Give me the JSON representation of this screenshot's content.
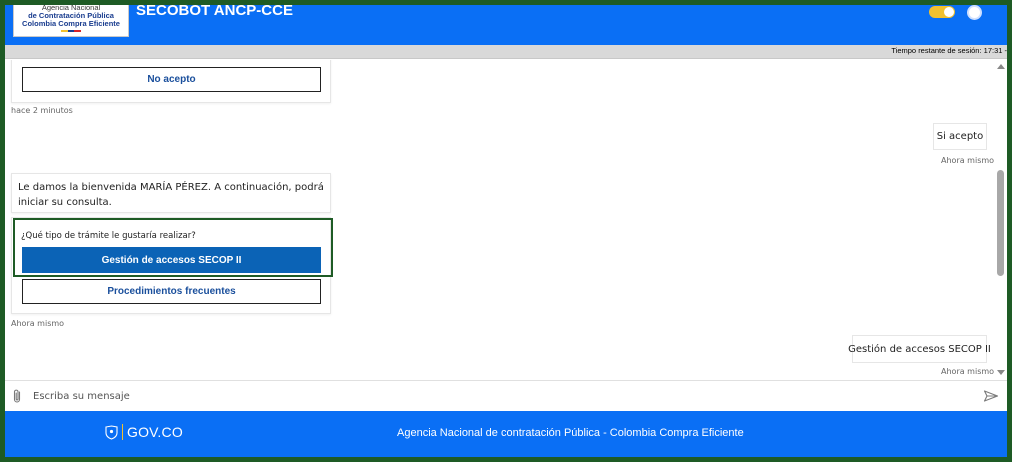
{
  "header": {
    "logo": {
      "line1": "Agencia Nacional",
      "line2": "de Contratación Pública",
      "line3": "Colombia Compra Eficiente"
    },
    "title": "SECOBOT ANCP-CCE",
    "theme_toggle_icon": "toggle-switch-icon",
    "accessibility_icon": "accessibility-icon"
  },
  "session": {
    "remaining_text": "Tiempo restante de sesión: 17:31 -"
  },
  "chat": {
    "messages": [
      {
        "type": "bot-options",
        "option": "No acepto",
        "time": "hace 2 minutos"
      },
      {
        "type": "user",
        "text": "Si acepto",
        "time": "Ahora mismo"
      },
      {
        "type": "bot",
        "text": "Le damos la bienvenida MARÍA PÉREZ. A continuación, podrá iniciar su consulta.",
        "question": "¿Qué tipo de trámite le gustaría realizar?",
        "options": [
          "Gestión de accesos SECOP II",
          "Procedimientos frecuentes"
        ],
        "time": "Ahora mismo"
      },
      {
        "type": "user",
        "text": "Gestión de accesos SECOP II",
        "time": "Ahora mismo"
      }
    ]
  },
  "input": {
    "placeholder": "Escriba su mensaje",
    "attach_icon": "paperclip-icon",
    "send_icon": "send-icon"
  },
  "footer": {
    "gov_logo_text": "GOV.CO",
    "agency_text": "Agencia Nacional de contratación Pública - Colombia Compra Eficiente"
  },
  "colors": {
    "brand_blue": "#0a6ff5",
    "button_blue": "#0b63b6",
    "link_blue": "#1a4f9c",
    "frame_green": "#1e5b25",
    "session_gray": "#d9d9d9"
  }
}
